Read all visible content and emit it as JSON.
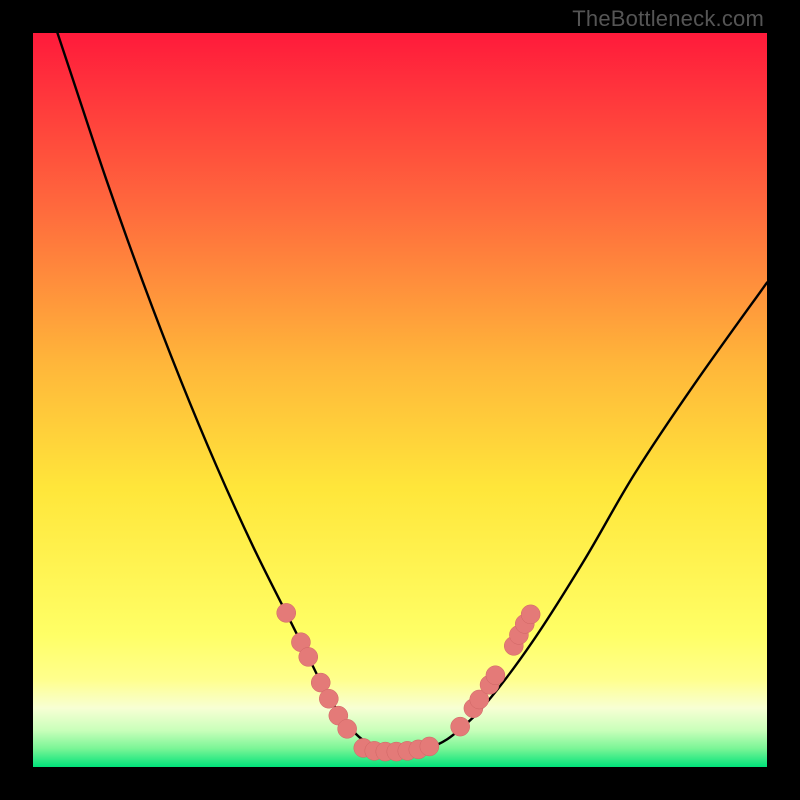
{
  "watermark": "TheBottleneck.com",
  "colors": {
    "border": "#000000",
    "gradient_top": "#ff1a3b",
    "gradient_mid_upper": "#ff8b3e",
    "gradient_mid": "#ffe63a",
    "gradient_lower_yellow": "#ffff8c",
    "gradient_pale": "#f7ffd4",
    "gradient_bottom": "#00e37a",
    "curve": "#000000",
    "marker": "#e47a78",
    "marker_stroke": "#cf6564"
  },
  "chart_data": {
    "type": "line",
    "title": "",
    "xlabel": "",
    "ylabel": "",
    "xlim": [
      0,
      100
    ],
    "ylim": [
      0,
      100
    ],
    "series": [
      {
        "name": "bottleneck-curve",
        "x": [
          0,
          5,
          10,
          15,
          20,
          25,
          30,
          35,
          38,
          40,
          42,
          44,
          46,
          48,
          50,
          52,
          55,
          58,
          62,
          68,
          75,
          82,
          90,
          100
        ],
        "values": [
          110,
          95,
          80,
          66,
          53,
          41,
          30,
          20,
          14,
          10,
          7,
          4.5,
          3,
          2.2,
          2,
          2.2,
          3,
          5,
          9,
          17,
          28,
          40,
          52,
          66
        ]
      }
    ],
    "markers": {
      "name": "highlighted-points",
      "points": [
        {
          "x": 34.5,
          "y": 21
        },
        {
          "x": 36.5,
          "y": 17
        },
        {
          "x": 37.5,
          "y": 15
        },
        {
          "x": 39.2,
          "y": 11.5
        },
        {
          "x": 40.3,
          "y": 9.3
        },
        {
          "x": 41.6,
          "y": 7.0
        },
        {
          "x": 42.8,
          "y": 5.2
        },
        {
          "x": 45.0,
          "y": 2.6
        },
        {
          "x": 46.5,
          "y": 2.2
        },
        {
          "x": 48.0,
          "y": 2.1
        },
        {
          "x": 49.5,
          "y": 2.1
        },
        {
          "x": 51.0,
          "y": 2.2
        },
        {
          "x": 52.5,
          "y": 2.4
        },
        {
          "x": 54.0,
          "y": 2.8
        },
        {
          "x": 58.2,
          "y": 5.5
        },
        {
          "x": 60.0,
          "y": 8.0
        },
        {
          "x": 60.8,
          "y": 9.2
        },
        {
          "x": 62.2,
          "y": 11.2
        },
        {
          "x": 63.0,
          "y": 12.5
        },
        {
          "x": 65.5,
          "y": 16.5
        },
        {
          "x": 66.2,
          "y": 18.0
        },
        {
          "x": 67.0,
          "y": 19.5
        },
        {
          "x": 67.8,
          "y": 20.8
        }
      ]
    }
  }
}
